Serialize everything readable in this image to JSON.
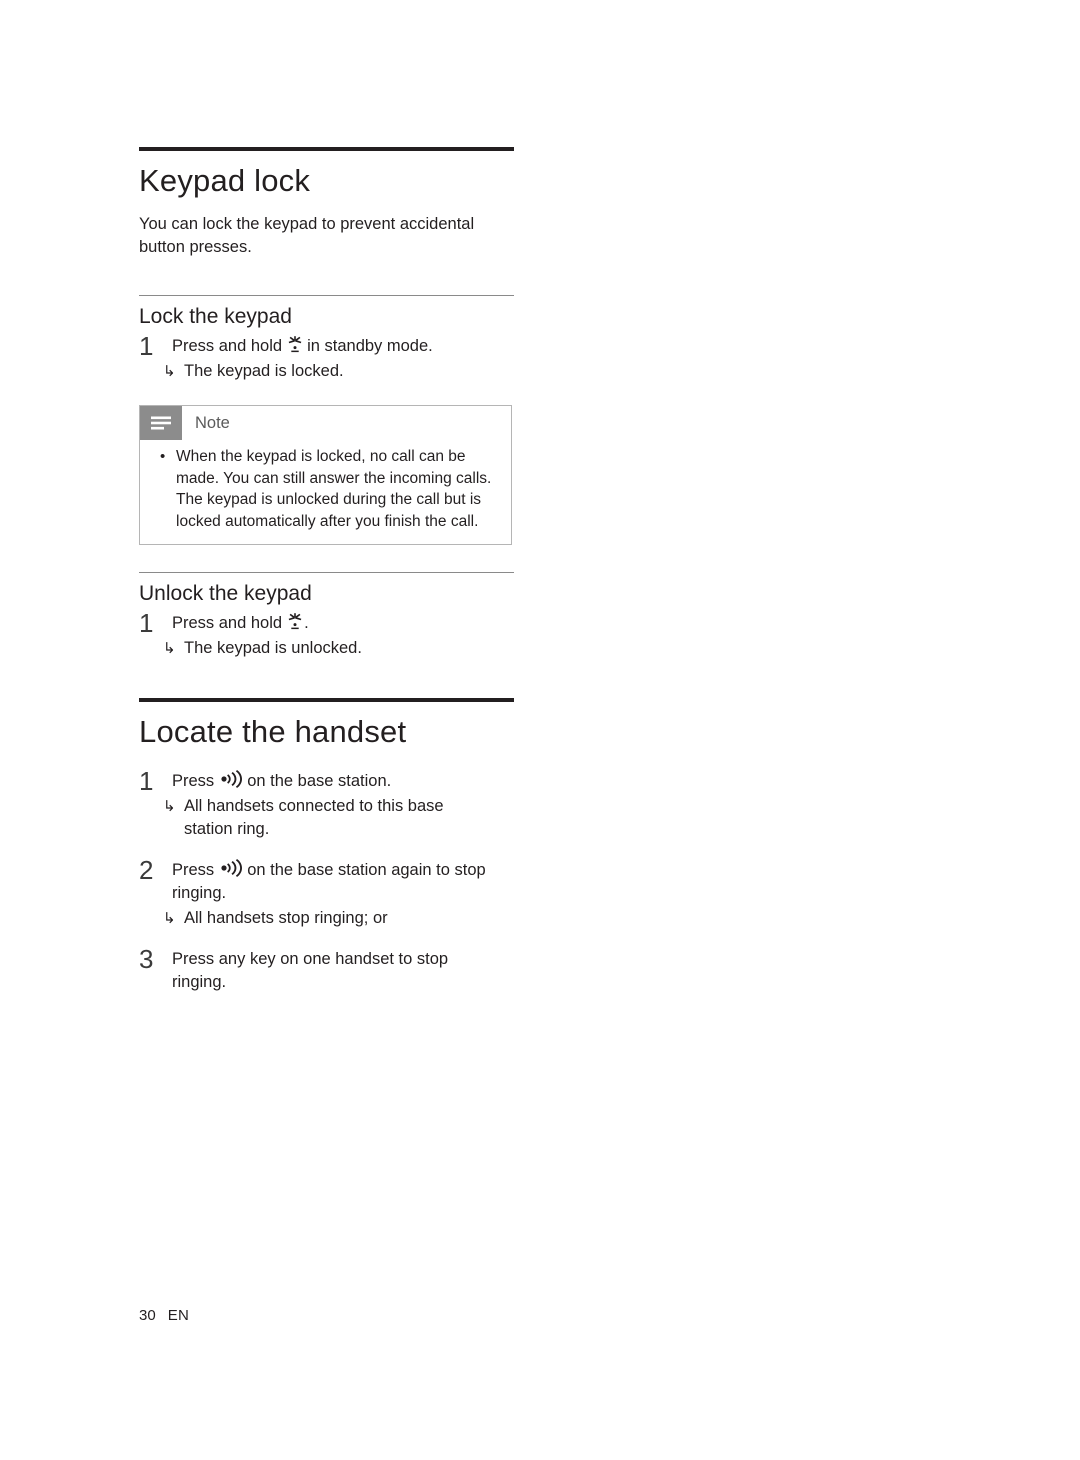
{
  "document": {
    "sections": [
      {
        "id": "keypad-lock",
        "title": "Keypad lock",
        "intro": "You can lock the keypad to prevent accidental button presses.",
        "subsections": [
          {
            "id": "lock-the-keypad",
            "title": "Lock the keypad",
            "steps": [
              {
                "num": "1",
                "text_before": "Press and hold",
                "icon": "asterisk-key-icon",
                "text_after": "in standby mode.",
                "result": "The keypad is locked.",
                "arrow": "↳"
              }
            ]
          },
          {
            "id": "unlock-the-keypad",
            "title": "Unlock the keypad",
            "steps": [
              {
                "num": "1",
                "text_before": "Press and hold",
                "icon": "asterisk-key-icon",
                "text_after": ".",
                "result": "The keypad is unlocked.",
                "arrow": "↳"
              }
            ]
          }
        ],
        "note": {
          "label": "Note",
          "icon": "note-lines-icon",
          "items": [
            {
              "bullet": "•",
              "text": "When the keypad is locked, no call can be made. You can still answer the incoming calls. The keypad is unlocked during the call but is locked automatically after you finish the call."
            }
          ]
        }
      },
      {
        "id": "locate-the-handset",
        "title": "Locate the handset",
        "steps": [
          {
            "num": "1",
            "text_before": "Press",
            "icon": "paging-key-icon",
            "text_after": "on the base station.",
            "result": "All handsets connected to this base station ring.",
            "arrow": "↳"
          },
          {
            "num": "2",
            "text_before": "Press",
            "icon": "paging-key-icon",
            "text_after": "on the base station again to stop ringing.",
            "result": "All handsets stop ringing; or",
            "arrow": "↳"
          },
          {
            "num": "3",
            "text_before": "Press any key on one handset to stop ringing.",
            "icon": "",
            "text_after": "",
            "result": "",
            "arrow": ""
          }
        ]
      }
    ]
  },
  "footer": {
    "page_number": "30",
    "language": "EN"
  }
}
